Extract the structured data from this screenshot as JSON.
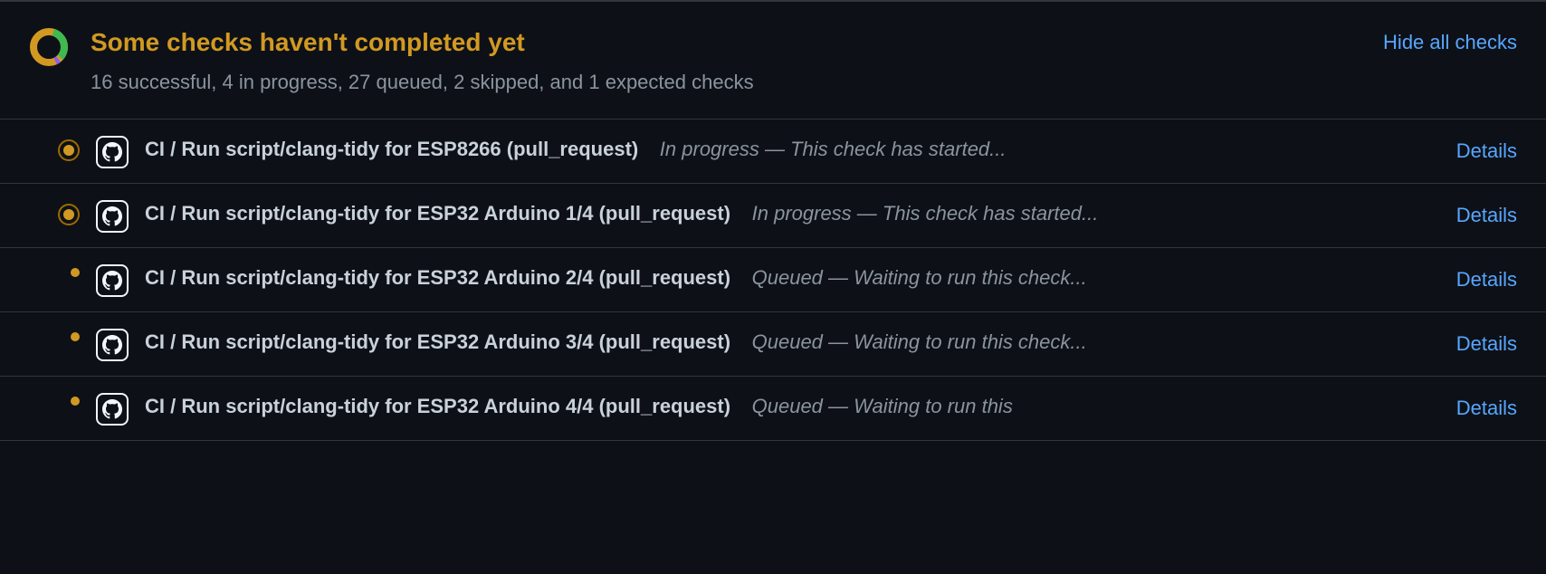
{
  "header": {
    "title": "Some checks haven't completed yet",
    "subtitle": "16 successful, 4 in progress, 27 queued, 2 skipped, and 1 expected checks",
    "hide_link": "Hide all checks"
  },
  "details_label": "Details",
  "checks": [
    {
      "status": "in_progress",
      "name": "CI / Run script/clang-tidy for ESP8266 (pull_request)",
      "status_text": "In progress — This check has started..."
    },
    {
      "status": "in_progress",
      "name": "CI / Run script/clang-tidy for ESP32 Arduino 1/4 (pull_request)",
      "status_text": "In progress — This check has started..."
    },
    {
      "status": "queued",
      "name": "CI / Run script/clang-tidy for ESP32 Arduino 2/4 (pull_request)",
      "status_text": "Queued — Waiting to run this check..."
    },
    {
      "status": "queued",
      "name": "CI / Run script/clang-tidy for ESP32 Arduino 3/4 (pull_request)",
      "status_text": "Queued — Waiting to run this check..."
    },
    {
      "status": "queued",
      "name": "CI / Run script/clang-tidy for ESP32 Arduino 4/4 (pull_request)",
      "status_text": "Queued — Waiting to run this"
    }
  ]
}
